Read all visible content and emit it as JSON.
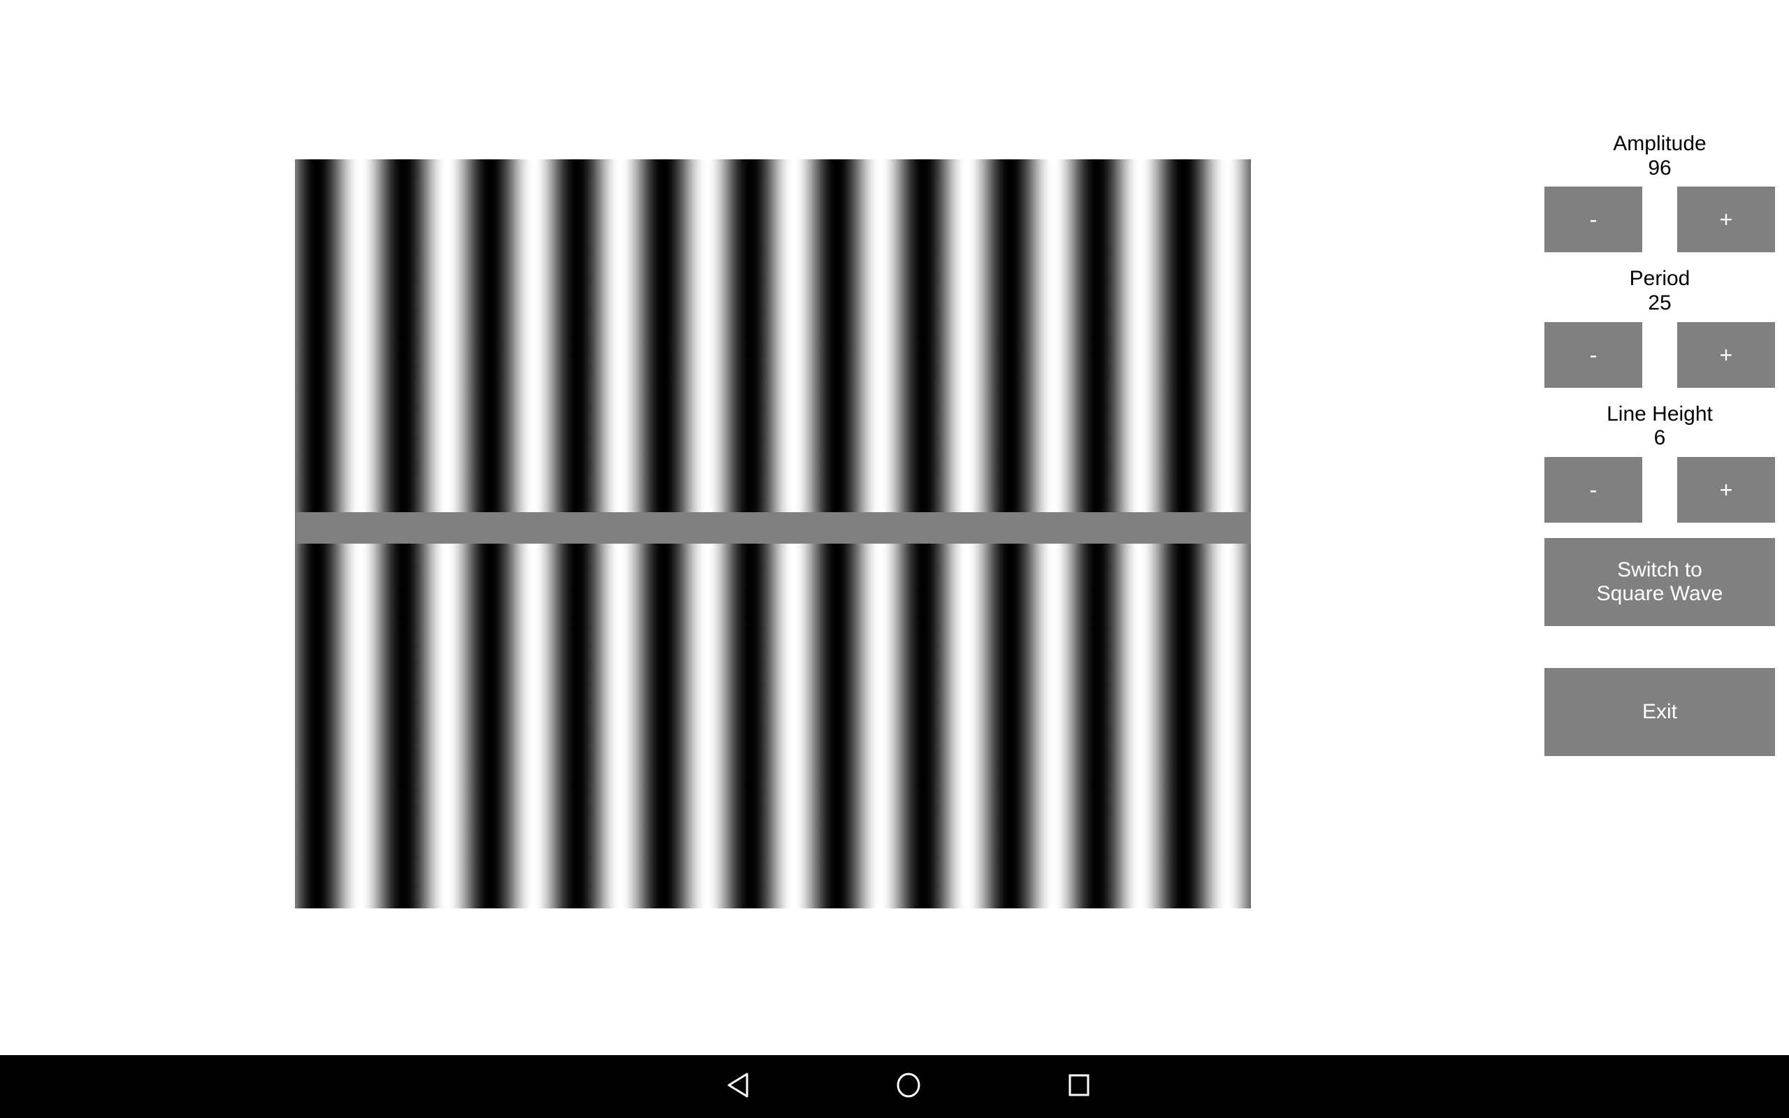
{
  "app": {
    "background_color": "#ffffff",
    "control_color": "#808080",
    "control_text_color": "#ffffff",
    "label_text_color": "#000000"
  },
  "stimulus": {
    "name": "sine-wave-grating",
    "waveform": "sine",
    "separator_bar_color": "#808080",
    "min_luminance": "#000000",
    "max_luminance": "#ffffff"
  },
  "controls": {
    "amplitude": {
      "label": "Amplitude",
      "value": "96",
      "decrement_label": "-",
      "increment_label": "+"
    },
    "period": {
      "label": "Period",
      "value": "25",
      "decrement_label": "-",
      "increment_label": "+"
    },
    "line_height": {
      "label": "Line Height",
      "value": "6",
      "decrement_label": "-",
      "increment_label": "+"
    },
    "switch_wave_label": "Switch to\nSquare Wave",
    "exit_label": "Exit"
  },
  "nav_bar": {
    "background_color": "#000000",
    "back_icon": "back-triangle-icon",
    "home_icon": "home-circle-icon",
    "recents_icon": "recents-square-icon"
  }
}
